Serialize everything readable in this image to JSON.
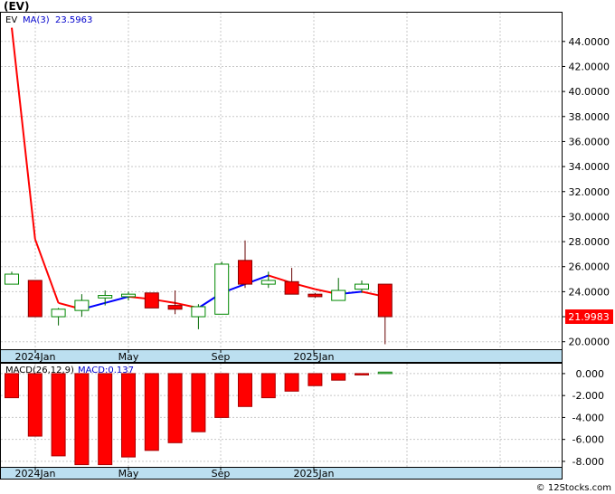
{
  "header": {
    "symbol": "(EV)"
  },
  "legend": {
    "symbol": "EV",
    "ma_label": "MA(3)",
    "ma_value": "23.5963"
  },
  "macd_legend": {
    "params": "MACD(26,12,9)",
    "value_label": "MACD:0.137"
  },
  "last_price_label": "21.9983",
  "watermark": "© 12Stocks.com",
  "colors": {
    "up": "#ffffff",
    "down": "#ff0000",
    "ma_up": "#0000ff",
    "ma_down": "#ff0000",
    "axis_band": "#bcdff0",
    "grid": "#c8c8c8",
    "price_tag": "#ff0000"
  },
  "chart_data": [
    {
      "type": "candlestick",
      "title": "(EV)",
      "ylim": [
        19.4,
        46.3
      ],
      "y_ticks": [
        "20.0000",
        "22.0000",
        "24.0000",
        "26.0000",
        "28.0000",
        "30.0000",
        "32.0000",
        "34.0000",
        "36.0000",
        "38.0000",
        "40.0000",
        "42.0000",
        "44.0000"
      ],
      "x_tick_labels": [
        "2024Jan",
        "May",
        "Sep",
        "2025Jan"
      ],
      "grid": true,
      "candles": [
        {
          "o": 24.6,
          "h": 25.6,
          "l": 24.6,
          "c": 25.4
        },
        {
          "o": 24.9,
          "h": 24.9,
          "l": 22.0,
          "c": 22.0
        },
        {
          "o": 22.0,
          "h": 22.7,
          "l": 21.3,
          "c": 22.6
        },
        {
          "o": 22.5,
          "h": 23.8,
          "l": 22.0,
          "c": 23.3
        },
        {
          "o": 23.5,
          "h": 24.1,
          "l": 22.9,
          "c": 23.7
        },
        {
          "o": 23.6,
          "h": 24.0,
          "l": 23.3,
          "c": 23.8
        },
        {
          "o": 23.9,
          "h": 23.9,
          "l": 22.7,
          "c": 22.7
        },
        {
          "o": 22.9,
          "h": 24.1,
          "l": 22.2,
          "c": 22.6
        },
        {
          "o": 22.0,
          "h": 23.0,
          "l": 21.0,
          "c": 22.8
        },
        {
          "o": 22.2,
          "h": 26.4,
          "l": 22.2,
          "c": 26.2
        },
        {
          "o": 26.5,
          "h": 28.1,
          "l": 24.3,
          "c": 24.6
        },
        {
          "o": 24.6,
          "h": 25.6,
          "l": 24.3,
          "c": 24.9
        },
        {
          "o": 24.8,
          "h": 25.9,
          "l": 23.8,
          "c": 23.8
        },
        {
          "o": 23.8,
          "h": 23.9,
          "l": 23.5,
          "c": 23.6
        },
        {
          "o": 23.3,
          "h": 25.1,
          "l": 23.3,
          "c": 24.1
        },
        {
          "o": 24.2,
          "h": 24.9,
          "l": 23.9,
          "c": 24.6
        },
        {
          "o": 24.6,
          "h": 24.6,
          "l": 19.8,
          "c": 22.0
        }
      ],
      "ma_series": {
        "name": "MA(3)",
        "values": [
          45.1,
          28.2,
          23.1,
          22.6,
          23.1,
          23.6,
          23.4,
          23.1,
          22.7,
          23.9,
          24.6,
          25.3,
          24.7,
          24.2,
          23.8,
          24.0,
          23.6
        ]
      }
    },
    {
      "type": "bar",
      "title": "MACD(26,12,9)",
      "ylim": [
        -8.5,
        0.9
      ],
      "y_ticks": [
        "0.000",
        "-2.000",
        "-4.000",
        "-6.000",
        "-8.000"
      ],
      "x_tick_labels": [
        "2024Jan",
        "May",
        "Sep",
        "2025Jan"
      ],
      "values": [
        -2.2,
        -5.7,
        -7.5,
        -8.3,
        -8.3,
        -7.6,
        -7.0,
        -6.3,
        -5.3,
        -4.0,
        -3.0,
        -2.2,
        -1.6,
        -1.1,
        -0.6,
        -0.05,
        0.137
      ]
    }
  ]
}
